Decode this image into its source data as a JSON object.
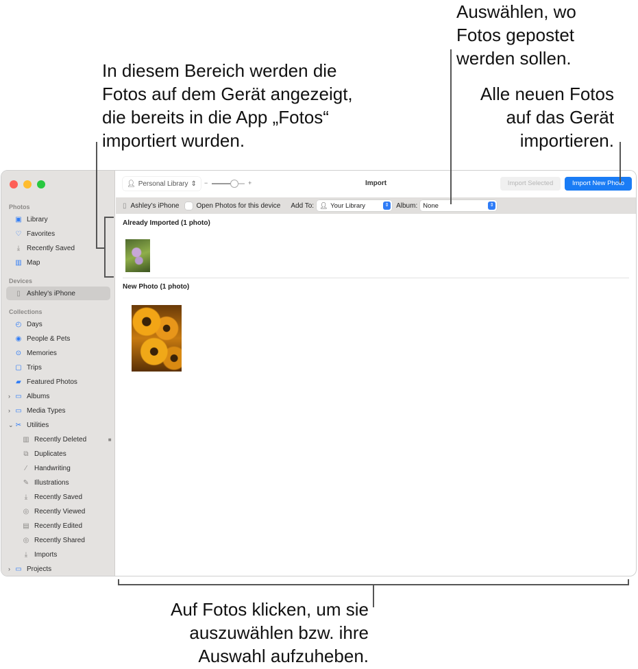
{
  "callouts": {
    "top_left": [
      "In diesem Bereich werden die",
      "Fotos auf dem Gerät angezeigt,",
      "die bereits in die App „Fotos“",
      "importiert wurden."
    ],
    "top_right_album": [
      "Auswählen, wo",
      "Fotos gepostet",
      "werden sollen."
    ],
    "top_right_import": [
      "Alle neuen Fotos",
      "auf das Gerät",
      "importieren."
    ],
    "bottom": [
      "Auf Fotos klicken, um sie",
      "auszuwählen bzw. ihre",
      "Auswahl aufzuheben."
    ]
  },
  "sidebar": {
    "sections": {
      "photos": "Photos",
      "devices": "Devices",
      "collections": "Collections"
    },
    "photos": [
      {
        "label": "Library",
        "icon": "library-icon"
      },
      {
        "label": "Favorites",
        "icon": "heart-icon"
      },
      {
        "label": "Recently Saved",
        "icon": "download-icon"
      },
      {
        "label": "Map",
        "icon": "map-icon"
      }
    ],
    "device": "Ashley’s iPhone",
    "collections": [
      {
        "label": "Days",
        "icon": "clock-icon"
      },
      {
        "label": "People & Pets",
        "icon": "person-circle-icon"
      },
      {
        "label": "Memories",
        "icon": "memories-icon"
      },
      {
        "label": "Trips",
        "icon": "suitcase-icon"
      },
      {
        "label": "Featured Photos",
        "icon": "photo-icon"
      },
      {
        "label": "Albums",
        "icon": "folder-icon"
      },
      {
        "label": "Media Types",
        "icon": "folder-icon"
      },
      {
        "label": "Utilities",
        "icon": "tools-icon"
      }
    ],
    "utilities": [
      {
        "label": "Recently Deleted",
        "icon": "trash-icon"
      },
      {
        "label": "Duplicates",
        "icon": "duplicate-icon"
      },
      {
        "label": "Handwriting",
        "icon": "pen-icon"
      },
      {
        "label": "Illustrations",
        "icon": "illustration-icon"
      },
      {
        "label": "Recently Saved",
        "icon": "download-icon"
      },
      {
        "label": "Recently Viewed",
        "icon": "eye-icon"
      },
      {
        "label": "Recently Edited",
        "icon": "edit-icon"
      },
      {
        "label": "Recently Shared",
        "icon": "shared-icon"
      },
      {
        "label": "Imports",
        "icon": "import-icon"
      }
    ],
    "projects": "Projects"
  },
  "toolbar": {
    "library": "Personal Library",
    "minus": "−",
    "plus": "+",
    "title": "Import",
    "import_selected": "Import Selected",
    "import_new": "Import New Photo"
  },
  "subbar": {
    "device": "Ashley’s iPhone",
    "open_photos": "Open Photos for this device",
    "add_to_label": "Add To:",
    "add_to_value": "Your Library",
    "album_label": "Album:",
    "album_value": "None"
  },
  "content": {
    "already_imported": "Already Imported (1 photo)",
    "new_photo": "New Photo (1 photo)"
  },
  "colors": {
    "accent": "#2f7cf6"
  }
}
